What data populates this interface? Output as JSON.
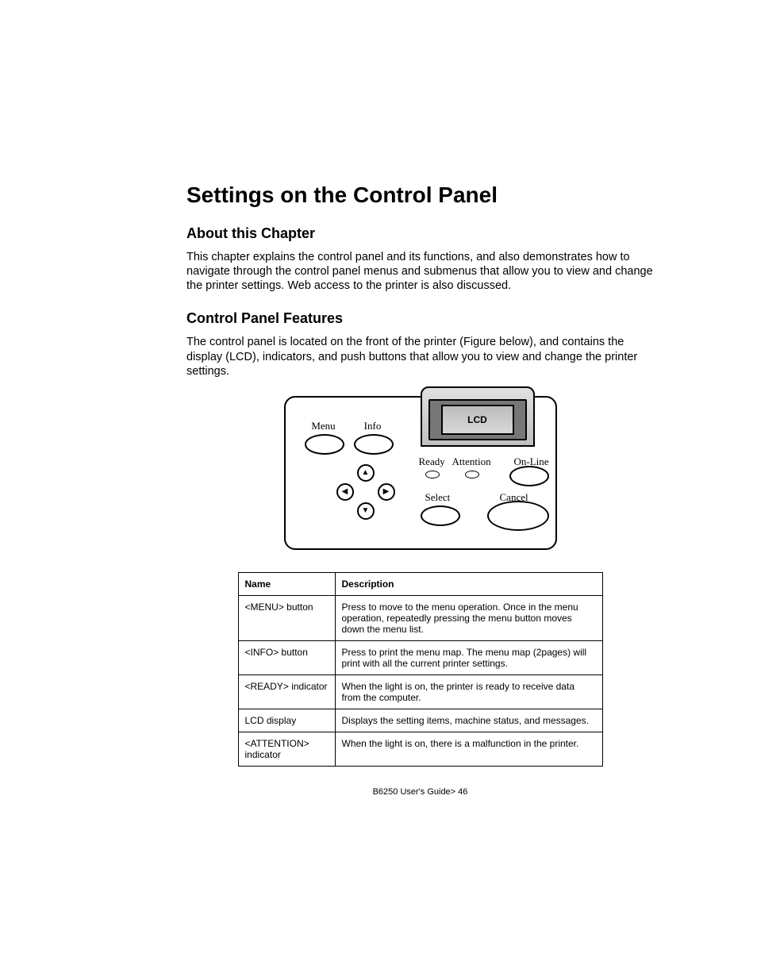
{
  "title": "Settings on the Control Panel",
  "section1": {
    "heading": "About this Chapter",
    "body": "This chapter explains the control panel and its functions, and also demonstrates how to navigate through the control panel menus and submenus that allow you to view and change the printer settings. Web access to the printer is also discussed."
  },
  "section2": {
    "heading": "Control Panel Features",
    "body": "The control panel is located on the front of the printer (Figure below), and contains the display (LCD), indicators, and push buttons that allow you to view and change the printer settings."
  },
  "diagram": {
    "menu": "Menu",
    "info": "Info",
    "lcd": "LCD",
    "ready": "Ready",
    "attention": "Attention",
    "online": "On-Line",
    "select": "Select",
    "cancel": "Cancel",
    "up": "▲",
    "down": "▼",
    "left": "◀",
    "right": "▶"
  },
  "table": {
    "headers": {
      "name": "Name",
      "desc": "Description"
    },
    "rows": [
      {
        "name": "<MENU> button",
        "desc": "Press to move to the menu operation. Once in the menu operation, repeatedly pressing the menu button moves down the menu list."
      },
      {
        "name": "<INFO> button",
        "desc": "Press to print the menu map. The menu map (2pages) will print with all the current printer settings."
      },
      {
        "name": "<READY> indicator",
        "desc": "When the light is on, the printer is ready to receive data from the computer."
      },
      {
        "name": "LCD display",
        "desc": "Displays the setting items, machine status, and messages."
      },
      {
        "name": "<ATTENTION> indicator",
        "desc": "When the light is on, there is a malfunction in the printer."
      }
    ]
  },
  "footer": "B6250 User's Guide> 46"
}
